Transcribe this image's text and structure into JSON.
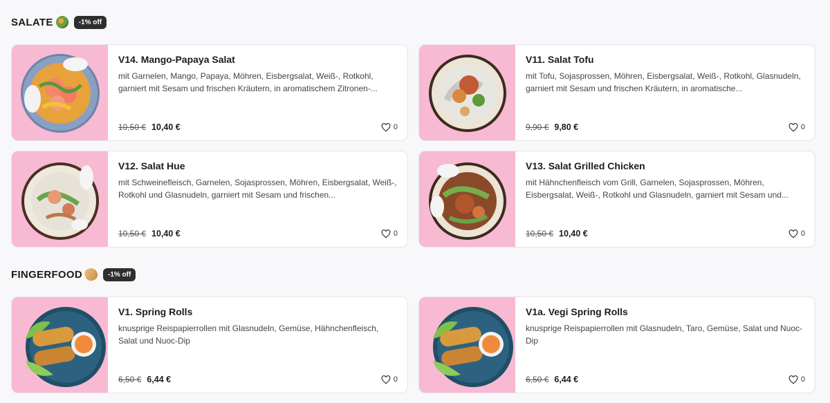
{
  "sections": [
    {
      "title": "SALATE",
      "emoji": "salad-bowl-icon",
      "badge": "-1% off",
      "items": [
        {
          "title": "V14. Mango-Papaya Salat",
          "description": "mit Garnelen, Mango, Papaya, Möhren, Eisbergsalat, Weiß-, Rotkohl, garniert mit Sesam und frischen Kräutern, in aromatischem Zitronen-...",
          "old_price": "10,50 €",
          "new_price": "10,40 €",
          "likes": "0"
        },
        {
          "title": "V11. Salat Tofu",
          "description": "mit Tofu, Sojasprossen, Möhren, Eisbergsalat, Weiß-, Rotkohl, Glasnudeln, garniert mit Sesam und frischen Kräutern, in aromatische...",
          "old_price": "9,90 €",
          "new_price": "9,80 €",
          "likes": "0"
        },
        {
          "title": "V12. Salat Hue",
          "description": "mit Schweinefleisch, Garnelen, Sojasprossen, Möhren, Eisbergsalat, Weiß-, Rotkohl und Glasnudeln, garniert mit Sesam und frischen...",
          "old_price": "10,50 €",
          "new_price": "10,40 €",
          "likes": "0"
        },
        {
          "title": "V13. Salat Grilled Chicken",
          "description": "mit Hähnchenfleisch vom Grill, Garnelen, Sojasprossen, Möhren, Eisbergsalat, Weiß-, Rotkohl und Glasnudeln, garniert mit Sesam und...",
          "old_price": "10,50 €",
          "new_price": "10,40 €",
          "likes": "0"
        }
      ]
    },
    {
      "title": "FINGERFOOD",
      "emoji": "spring-roll-icon",
      "badge": "-1% off",
      "items": [
        {
          "title": "V1. Spring Rolls",
          "description": "knusprige Reispapierrollen mit Glasnudeln, Gemüse, Hähnchenfleisch, Salat und Nuoc-Dip",
          "old_price": "6,50 €",
          "new_price": "6,44 €",
          "likes": "0"
        },
        {
          "title": "V1a. Vegi Spring Rolls",
          "description": "knusprige Reispapierrollen mit Glasnudeln, Taro, Gemüse, Salat und Nuoc-Dip",
          "old_price": "6,50 €",
          "new_price": "6,44 €",
          "likes": "0"
        }
      ]
    }
  ],
  "colors": {
    "image_background": "#f8b9d3",
    "badge_background": "#2e2e2e",
    "page_background": "#f8f8fb"
  }
}
